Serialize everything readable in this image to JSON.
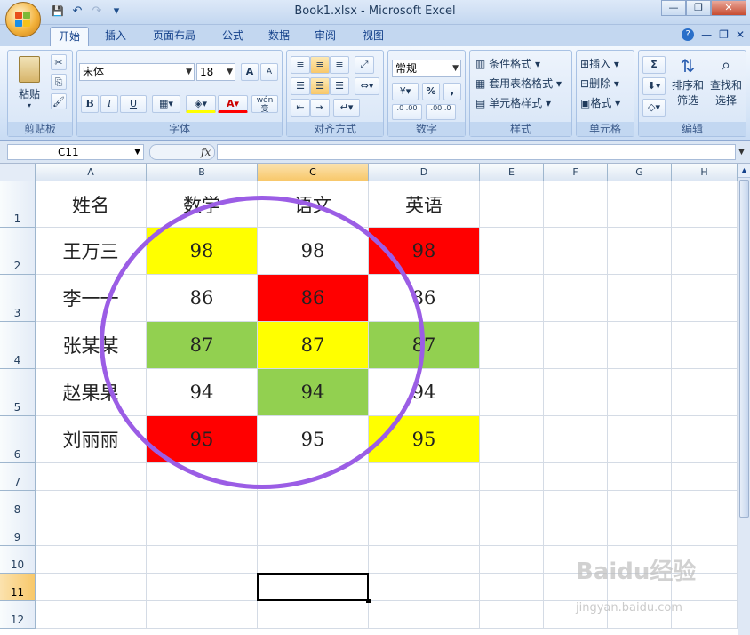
{
  "window": {
    "title": "Book1.xlsx - Microsoft Excel",
    "controls": {
      "minimize": "—",
      "restore": "❐",
      "close": "✕"
    }
  },
  "qat": {
    "save": "💾",
    "undo": "↶",
    "redo": "↷",
    "more": "▾"
  },
  "tabs": [
    {
      "label": "开始",
      "active": true
    },
    {
      "label": "插入",
      "active": false
    },
    {
      "label": "页面布局",
      "active": false
    },
    {
      "label": "公式",
      "active": false
    },
    {
      "label": "数据",
      "active": false
    },
    {
      "label": "审阅",
      "active": false
    },
    {
      "label": "视图",
      "active": false
    }
  ],
  "ribbon": {
    "clipboard": {
      "paste": "粘贴",
      "label": "剪贴板"
    },
    "font": {
      "family": "宋体",
      "size": "18",
      "bold": "B",
      "italic": "I",
      "underline": "U",
      "grow": "A",
      "shrink": "A",
      "phonetic": "wén 变",
      "label": "字体"
    },
    "align": {
      "label": "对齐方式"
    },
    "number": {
      "format": "常规",
      "percent": "%",
      "comma": ",",
      "inc_decimal": ".0 .00",
      "dec_decimal": ".00 .0",
      "label": "数字"
    },
    "styles": {
      "conditional": "条件格式",
      "table": "套用表格格式",
      "cell": "单元格样式",
      "label": "样式"
    },
    "cells": {
      "insert": "插入",
      "delete": "删除",
      "format": "格式",
      "label": "单元格"
    },
    "editing": {
      "sum": "Σ",
      "sort": "排序和",
      "sort2": "筛选",
      "find": "查找和",
      "find2": "选择",
      "label": "编辑"
    }
  },
  "formula_bar": {
    "name_box": "C11",
    "fx": "fx",
    "value": ""
  },
  "columns": [
    "A",
    "B",
    "C",
    "D",
    "E",
    "F",
    "G",
    "H"
  ],
  "rows": [
    "1",
    "2",
    "3",
    "4",
    "5",
    "6",
    "7",
    "8",
    "9",
    "10",
    "11",
    "12"
  ],
  "selected": {
    "column": "C",
    "row": "11"
  },
  "sheet": {
    "headers": [
      "姓名",
      "数学",
      "语文",
      "英语"
    ],
    "data": [
      {
        "name": "王万三",
        "scores": [
          "98",
          "98",
          "98"
        ],
        "fills": [
          "#ffff00",
          "#ffffff",
          "#ff0000"
        ]
      },
      {
        "name": "李一一",
        "scores": [
          "86",
          "86",
          "86"
        ],
        "fills": [
          "#ffffff",
          "#ff0000",
          "#ffffff"
        ]
      },
      {
        "name": "张某某",
        "scores": [
          "87",
          "87",
          "87"
        ],
        "fills": [
          "#92d050",
          "#ffff00",
          "#92d050"
        ]
      },
      {
        "name": "赵果果",
        "scores": [
          "94",
          "94",
          "94"
        ],
        "fills": [
          "#ffffff",
          "#92d050",
          "#ffffff"
        ]
      },
      {
        "name": "刘丽丽",
        "scores": [
          "95",
          "95",
          "95"
        ],
        "fills": [
          "#ff0000",
          "#ffffff",
          "#ffff00"
        ]
      }
    ]
  },
  "annotation": {
    "color": "#9b5de5"
  },
  "watermark": {
    "logo": "Baidu经验",
    "url": "jingyan.baidu.com"
  }
}
